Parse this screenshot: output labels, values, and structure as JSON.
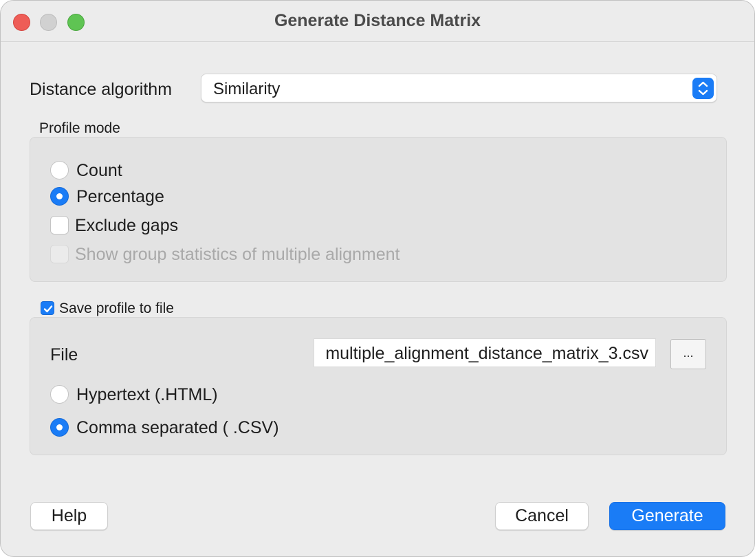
{
  "window": {
    "title": "Generate Distance Matrix"
  },
  "distance": {
    "label": "Distance algorithm",
    "selected": "Similarity"
  },
  "profile_mode": {
    "label": "Profile mode",
    "options": [
      {
        "label": "Count",
        "selected": false
      },
      {
        "label": "Percentage",
        "selected": true
      }
    ],
    "exclude_gaps": {
      "label": "Exclude gaps",
      "checked": false
    },
    "group_stats": {
      "label": "Show group statistics of multiple alignment",
      "checked": false,
      "enabled": false
    }
  },
  "save": {
    "label": "Save profile to file",
    "checked": true,
    "file_label": "File",
    "file_value": "multiple_alignment_distance_matrix_3.csv",
    "browse_label": "...",
    "formats": [
      {
        "label": "Hypertext  (.HTML)",
        "selected": false
      },
      {
        "label": "Comma separated ( .CSV)",
        "selected": true
      }
    ]
  },
  "buttons": {
    "help": "Help",
    "cancel": "Cancel",
    "generate": "Generate"
  },
  "colors": {
    "accent": "#1a7cf6",
    "window_bg": "#ececec",
    "group_bg": "#e3e3e3"
  }
}
